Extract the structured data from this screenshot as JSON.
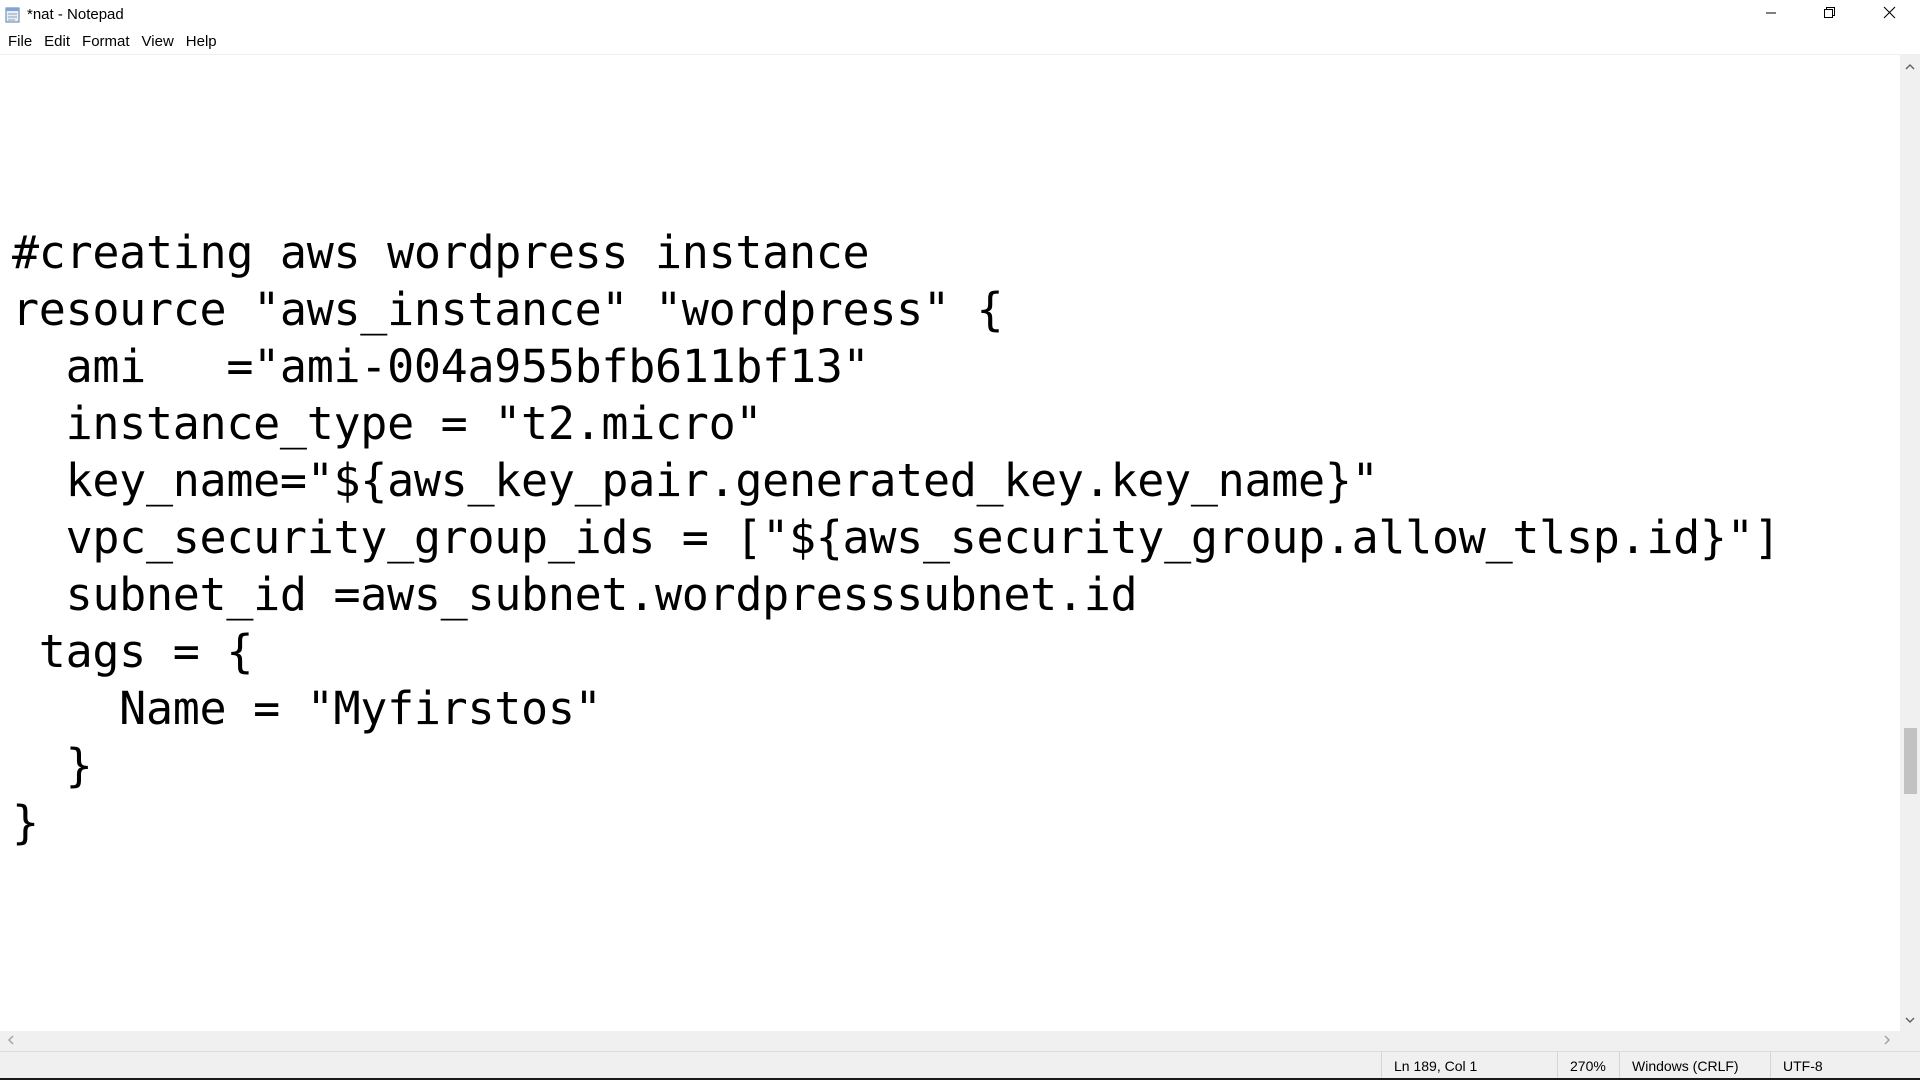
{
  "window": {
    "title": "*nat - Notepad",
    "icon": "notepad-icon",
    "controls": {
      "minimize": "minimize-icon",
      "maximize": "restore-icon",
      "close": "close-icon"
    }
  },
  "menu": {
    "items": [
      "File",
      "Edit",
      "Format",
      "View",
      "Help"
    ]
  },
  "editor": {
    "lines": [
      "#creating aws wordpress instance",
      "resource \"aws_instance\" \"wordpress\" {",
      "  ami   =\"ami-004a955bfb611bf13\"",
      "  instance_type = \"t2.micro\"",
      "  key_name=\"${aws_key_pair.generated_key.key_name}\"",
      "  vpc_security_group_ids = [\"${aws_security_group.allow_tlsp.id}\"]",
      "  subnet_id =aws_subnet.wordpresssubnet.id",
      " tags = {",
      "    Name = \"Myfirstos\"",
      "  }",
      "}"
    ],
    "scroll_position_fraction": 0.7
  },
  "status": {
    "position": "Ln 189, Col 1",
    "zoom": "270%",
    "line_ending": "Windows (CRLF)",
    "encoding": "UTF-8"
  },
  "colors": {
    "background": "#ffffff",
    "chrome": "#f0f0f0",
    "scroll_thumb": "#c2c2c2",
    "text": "#000000"
  }
}
